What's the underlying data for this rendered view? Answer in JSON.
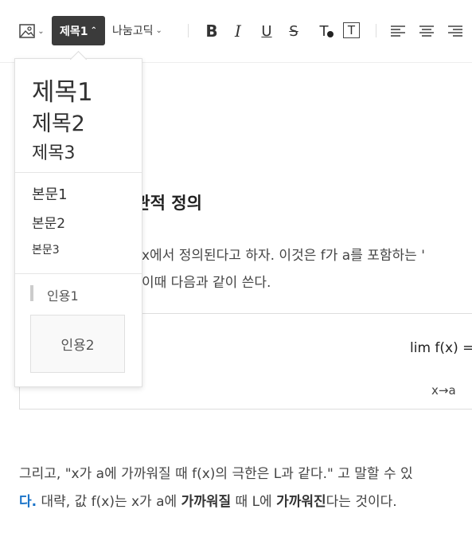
{
  "toolbar": {
    "image_icon": "image-icon",
    "heading_label": "제목1",
    "font_label": "나눔고딕",
    "bold_label": "B",
    "italic_label": "I",
    "underline_label": "U",
    "strike_label": "S",
    "text_color_label": "T",
    "text_bg_label": "T"
  },
  "dropdown": {
    "headings": [
      "제목1",
      "제목2",
      "제목3"
    ],
    "bodies": [
      "본문1",
      "본문2",
      "본문3"
    ],
    "quote1": "인용1",
    "quote2": "인용2"
  },
  "content": {
    "section_title_visible": "직관적 정의",
    "para1_visible": "x에서 정의된다고 하자. 이것은 f가 a를 포함하는 '",
    "para2_visible": "이때 다음과 같이 쓴다.",
    "formula_main": "lim f(x) =",
    "formula_sub": "x→a",
    "para3": "그리고, \"x가 a에 가까워질 때 f(x)의 극한은 L과 같다.\" 고 말할 수 있",
    "para4_blue": "다.",
    "para4_a": " 대략, 값 f(x)는 x가 a에 ",
    "para4_b": "가까워질",
    "para4_c": " 때 L에 ",
    "para4_d": "가까워진",
    "para4_e": "다는 것이다."
  }
}
